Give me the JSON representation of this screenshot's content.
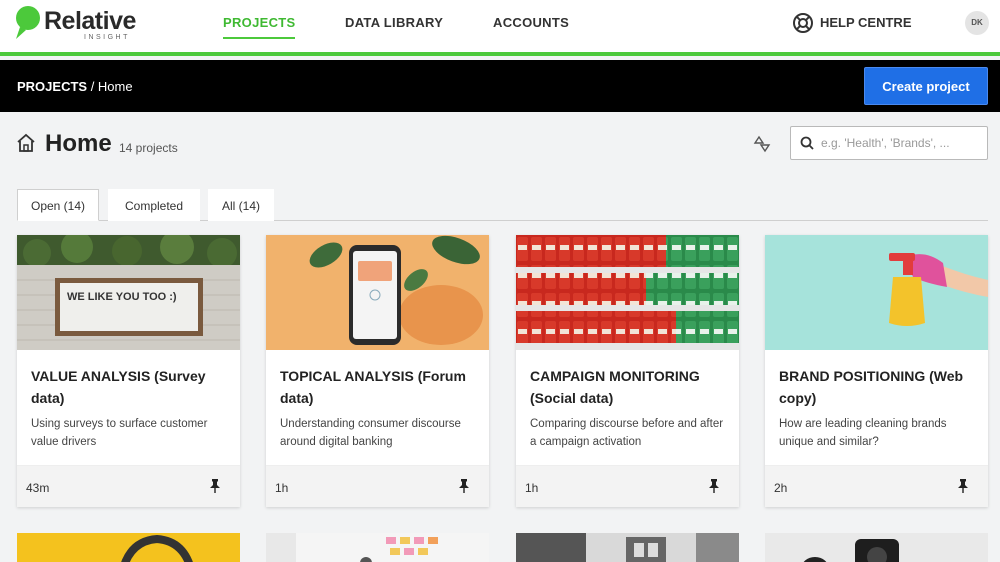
{
  "nav": {
    "brand": "Relative",
    "brand_sub": "INSIGHT",
    "links": [
      "PROJECTS",
      "DATA LIBRARY",
      "ACCOUNTS"
    ],
    "help": "HELP CENTRE",
    "avatar": "DK"
  },
  "bar": {
    "crumb_root": "PROJECTS",
    "crumb_sep": " / ",
    "crumb_page": "Home",
    "create_label": "Create project"
  },
  "page": {
    "title": "Home",
    "count": "14 projects",
    "search_placeholder": "e.g. 'Health', 'Brands', ..."
  },
  "tabs": [
    "Open (14)",
    "Completed",
    "All (14)"
  ],
  "cards": [
    {
      "title": "VALUE ANALYSIS (Survey data)",
      "desc": "Using surveys to surface customer value drivers",
      "time": "43m",
      "img_text": "WE LIKE YOU TOO :)"
    },
    {
      "title": "TOPICAL ANALYSIS (Forum data)",
      "desc": "Understanding consumer discourse around digital banking",
      "time": "1h"
    },
    {
      "title": "CAMPAIGN MONITORING (Social data)",
      "desc": "Comparing discourse before and after a campaign activation",
      "time": "1h"
    },
    {
      "title": "BRAND POSITIONING (Web copy)",
      "desc": "How are leading cleaning brands unique and similar?",
      "time": "2h"
    }
  ],
  "colors": {
    "accent_green": "#4cc93b",
    "button_blue": "#1f6fe6"
  }
}
